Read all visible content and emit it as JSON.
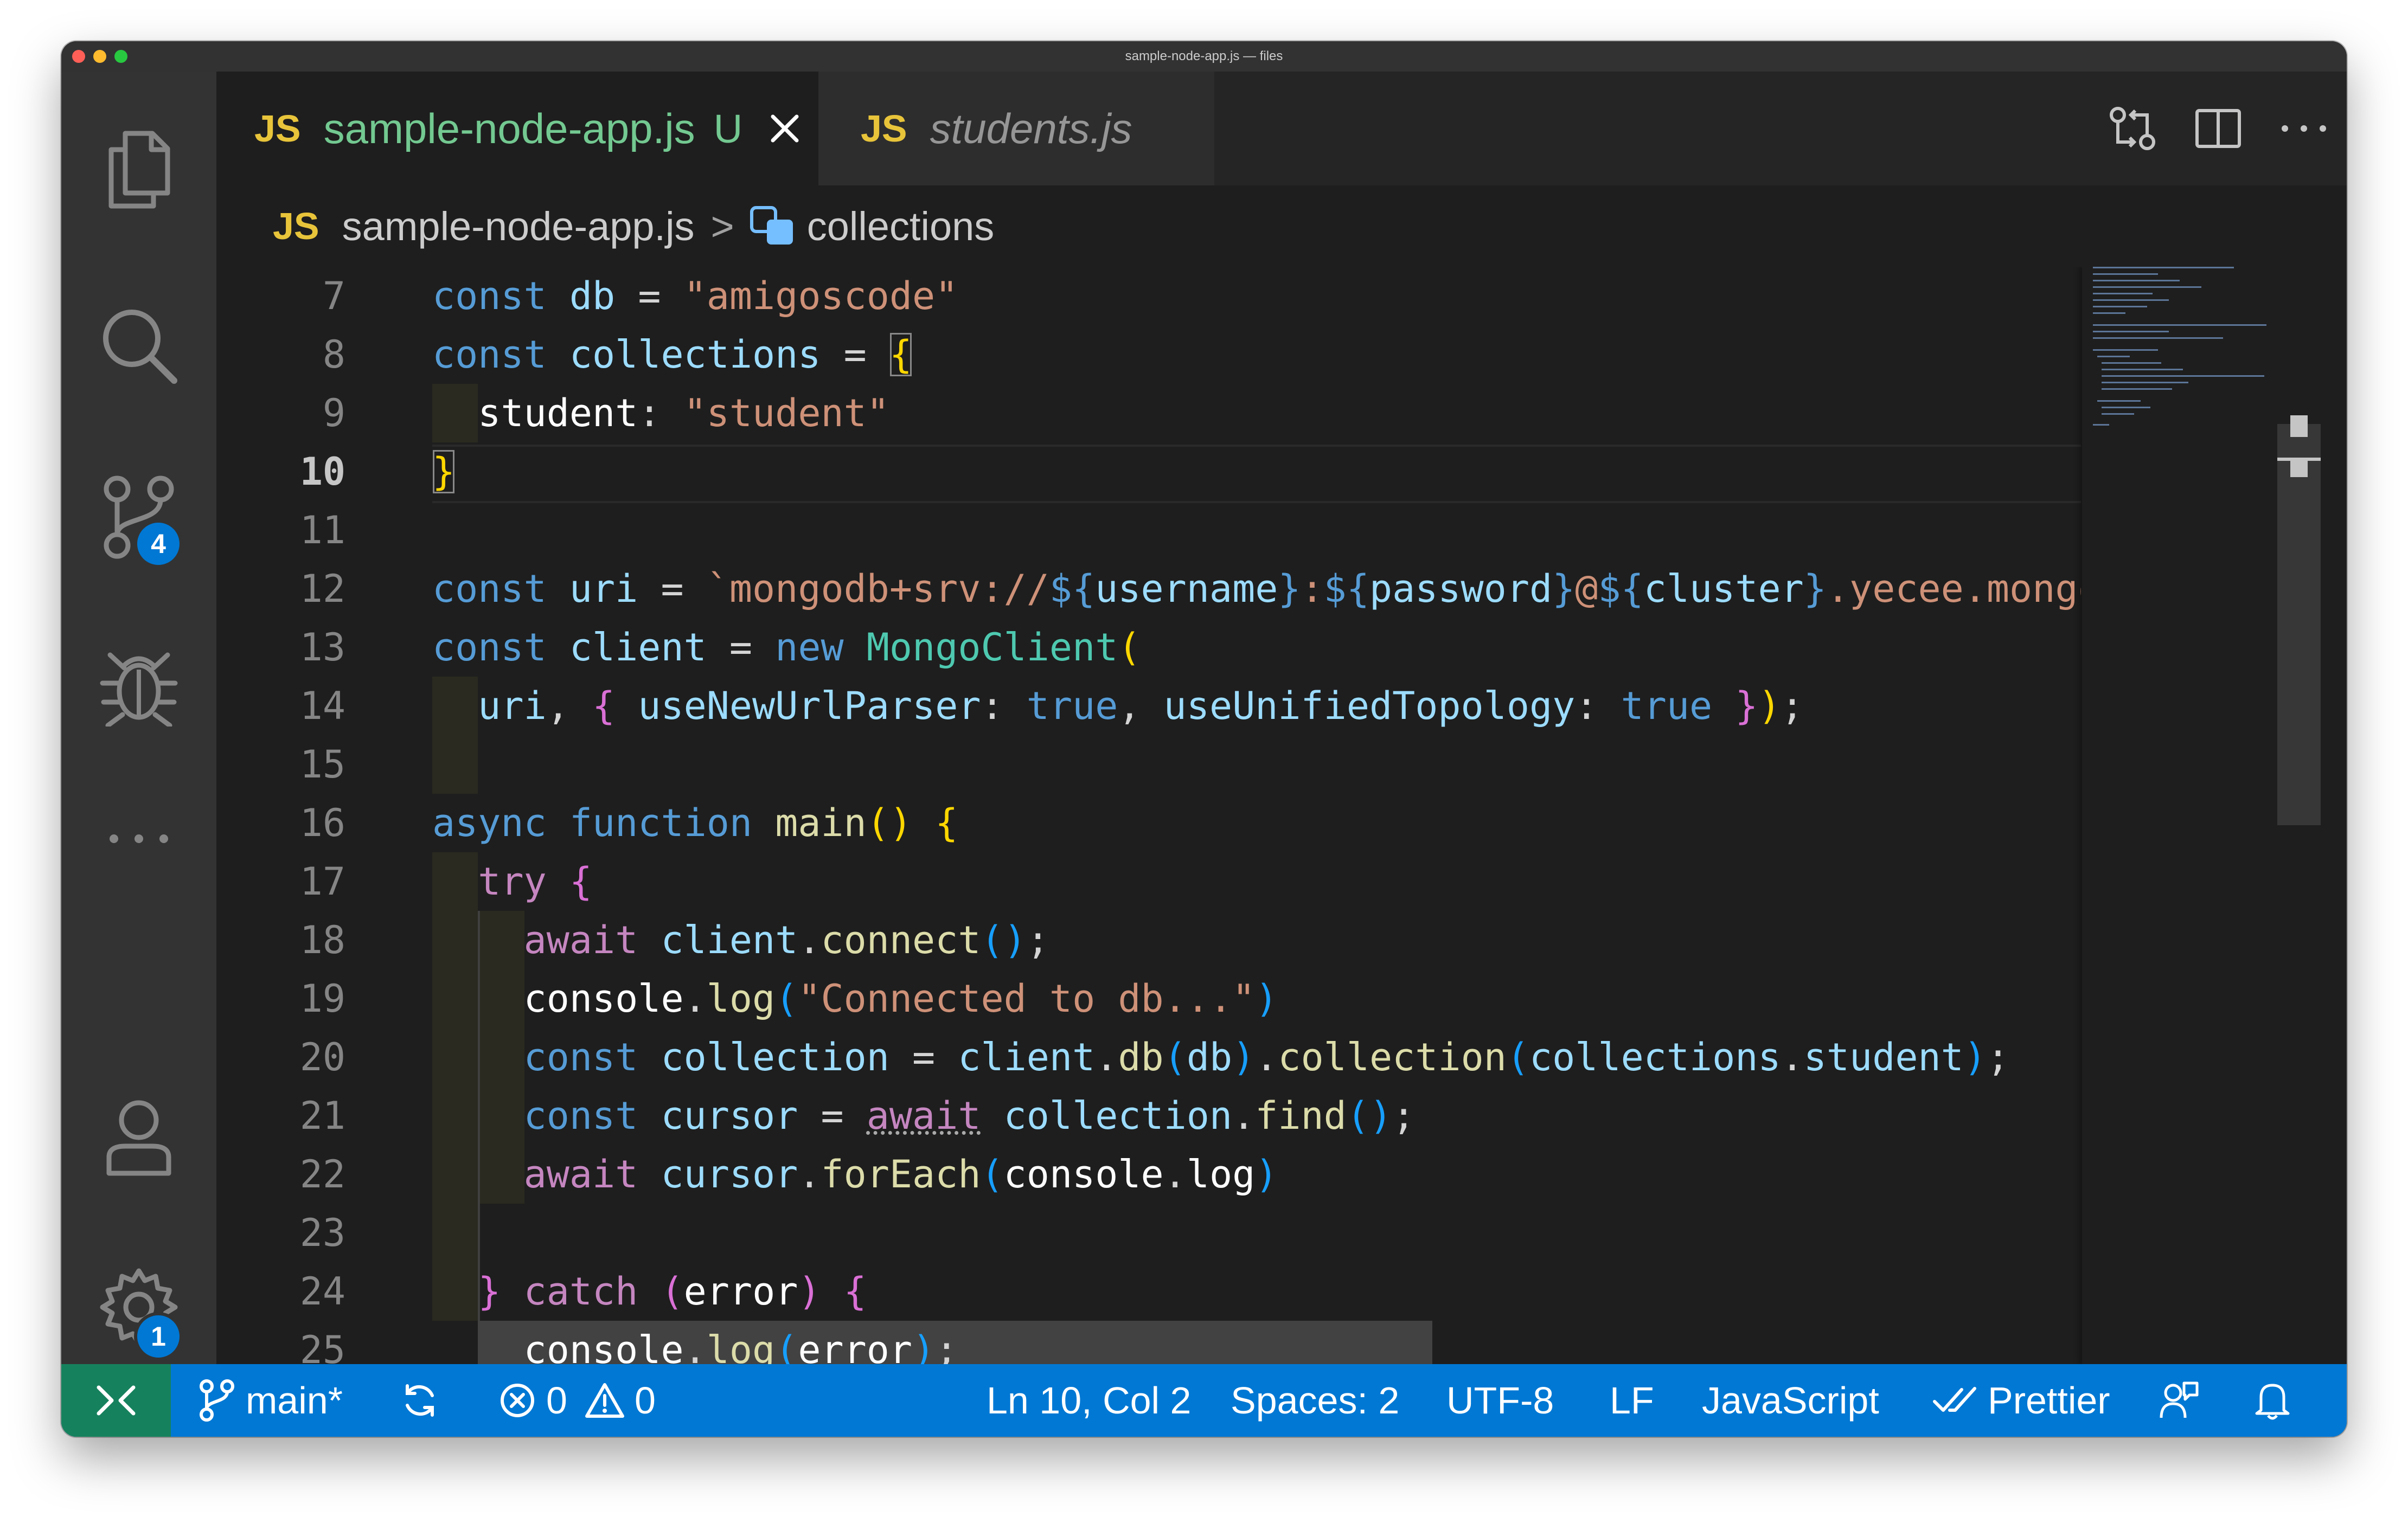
{
  "window_title": "sample-node-app.js — files",
  "colors": {
    "status_bar": "#0078d4",
    "remote_indicator": "#16825d",
    "js_badge": "#e8c43a",
    "active_tab_label": "#73c991",
    "badge": "#0078d4"
  },
  "activity_bar": {
    "items": [
      {
        "name": "explorer",
        "icon": "files-icon"
      },
      {
        "name": "search",
        "icon": "search-icon"
      },
      {
        "name": "source-control",
        "icon": "source-control-icon",
        "badge": "4"
      },
      {
        "name": "run-and-debug",
        "icon": "debug-icon"
      },
      {
        "name": "more",
        "icon": "ellipsis-icon"
      },
      {
        "name": "accounts",
        "icon": "account-icon"
      },
      {
        "name": "manage",
        "icon": "gear-icon",
        "badge": "1"
      }
    ]
  },
  "tabs": [
    {
      "lang": "JS",
      "label": "sample-node-app.js",
      "status": "U",
      "active": true
    },
    {
      "lang": "JS",
      "label": "students.js",
      "active": false
    }
  ],
  "breadcrumb": {
    "lang": "JS",
    "file": "sample-node-app.js",
    "separator": ">",
    "symbol": "collections"
  },
  "editor": {
    "current_line": 10,
    "line_numbers": [
      "7",
      "8",
      "9",
      "10",
      "11",
      "12",
      "13",
      "14",
      "15",
      "16",
      "17",
      "18",
      "19",
      "20",
      "21",
      "22",
      "23",
      "24",
      "25"
    ]
  },
  "status_bar": {
    "branch": "main*",
    "errors": "0",
    "warnings": "0",
    "cursor_position": "Ln 10, Col 2",
    "indentation": "Spaces: 2",
    "encoding": "UTF-8",
    "line_ending": "LF",
    "language": "JavaScript",
    "formatter": "Prettier"
  }
}
